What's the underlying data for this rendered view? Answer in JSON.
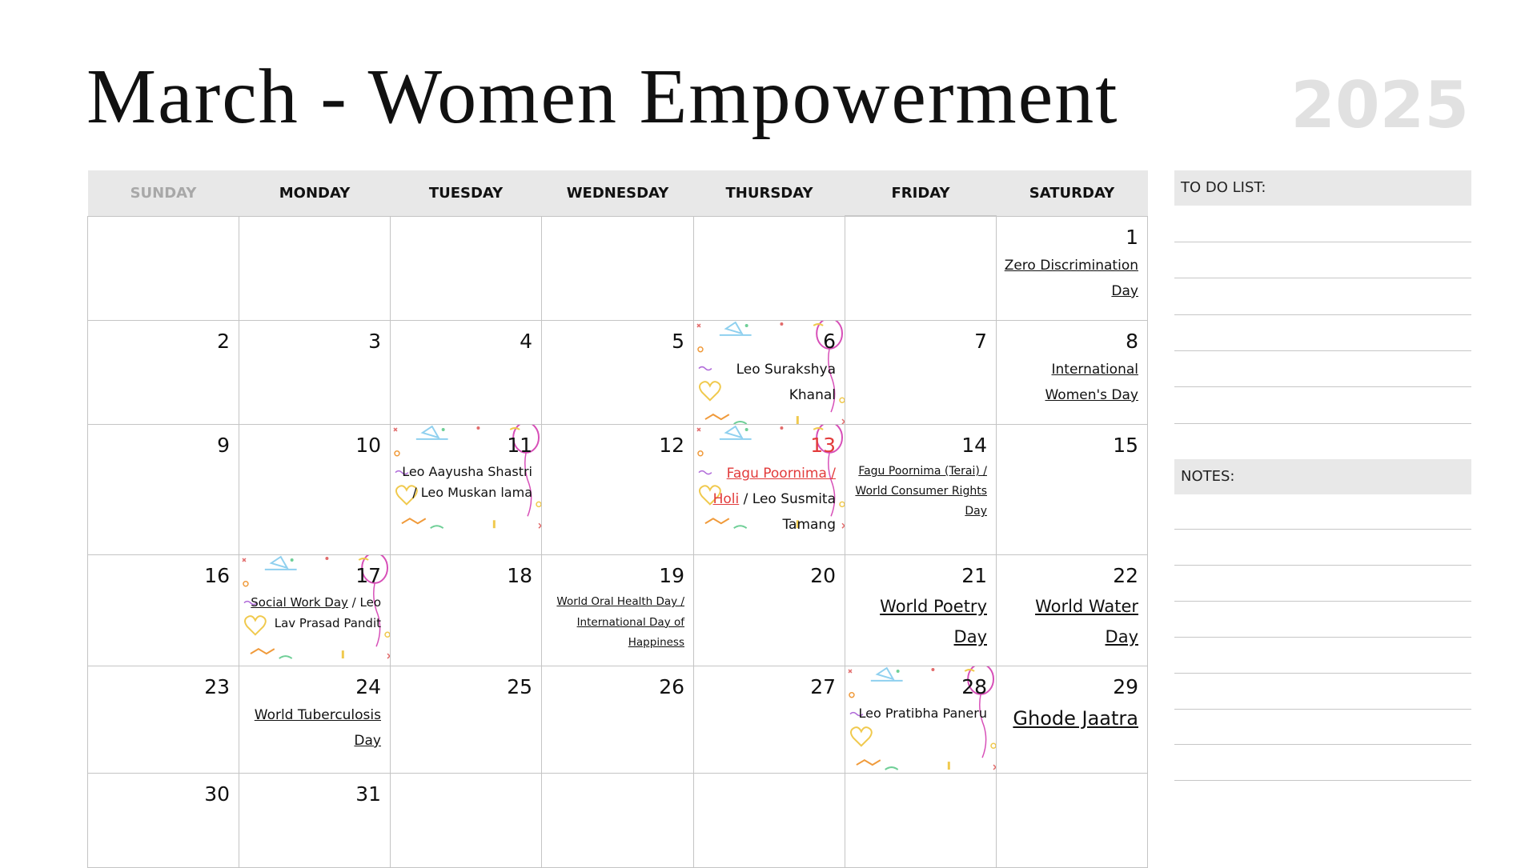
{
  "header": {
    "title": "March - Women Empowerment",
    "year": "2025"
  },
  "weekdays": [
    "SUNDAY",
    "MONDAY",
    "TUESDAY",
    "WEDNESDAY",
    "THURSDAY",
    "FRIDAY",
    "SATURDAY"
  ],
  "days": {
    "d1": "1",
    "d2": "2",
    "d3": "3",
    "d4": "4",
    "d5": "5",
    "d6": "6",
    "d7": "7",
    "d8": "8",
    "d9": "9",
    "d10": "10",
    "d11": "11",
    "d12": "12",
    "d13": "13",
    "d14": "14",
    "d15": "15",
    "d16": "16",
    "d17": "17",
    "d18": "18",
    "d19": "19",
    "d20": "20",
    "d21": "21",
    "d22": "22",
    "d23": "23",
    "d24": "24",
    "d25": "25",
    "d26": "26",
    "d27": "27",
    "d28": "28",
    "d29": "29",
    "d30": "30",
    "d31": "31"
  },
  "events": {
    "e1": "Zero Discrimination Day",
    "e6": "Leo Surakshya Khanal",
    "e8": "International Women's Day",
    "e11": "Leo Aayusha Shastri / Leo Muskan lama",
    "e13_link": "Fagu Poornima / Holi",
    "e13_rest": " / Leo Susmita Tamang",
    "e14": "Fagu Poornima (Terai) / World Consumer Rights Day",
    "e17_link": "Social Work Day",
    "e17_rest": " / Leo Lav Prasad Pandit",
    "e19": "World Oral Health Day / International Day of Happiness",
    "e21": "World Poetry Day",
    "e22": "World Water Day",
    "e24": "World Tuberculosis Day",
    "e28": "Leo Pratibha Paneru",
    "e29": "Ghode Jaatra"
  },
  "sidebar": {
    "todo_label": "TO DO LIST:",
    "notes_label": "NOTES:"
  },
  "colors": {
    "holiday_red": "#e23b3b",
    "header_gray": "#e8e8e8",
    "year_gray": "#e1e1e1"
  }
}
